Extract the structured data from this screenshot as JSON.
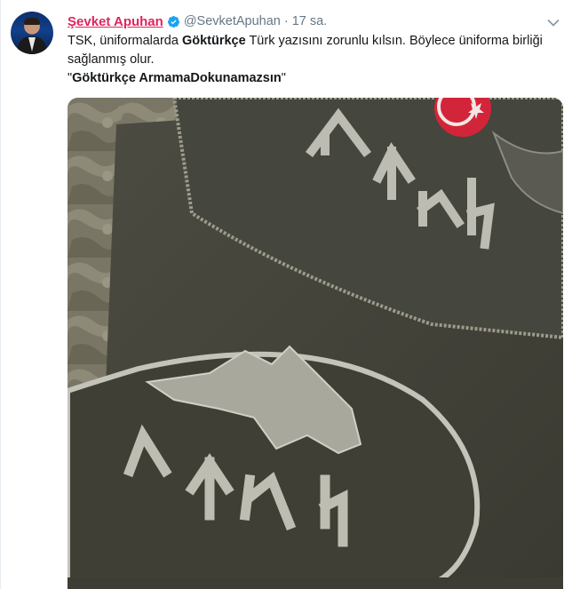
{
  "tweet": {
    "author_name": "Şevket Apuhan",
    "handle": "@SevketApuhan",
    "separator": "·",
    "time": "17 sa.",
    "text_part1": "TSK, üniformalarda ",
    "text_bold": "Göktürkçe",
    "text_part2": " Türk yazısını zorunlu kılsın. Böylece üniforma birliği",
    "text_line2": "sağlanmış olur.",
    "quote_open": "\"",
    "quote_bold": "Göktürkçe ArmamaDokunamazsın",
    "quote_close": "\"",
    "verified_icon": "verified-badge-icon",
    "caret_icon": "chevron-down-icon",
    "colors": {
      "name": "#e0245e",
      "muted": "#657786",
      "verified": "#1da1f2"
    }
  },
  "media": {
    "patch_glyphs_top": "𐰀𐰖𐰆𐰴",
    "patch_glyphs_bottom": "𐰀𐰖𐰆𐰴"
  }
}
